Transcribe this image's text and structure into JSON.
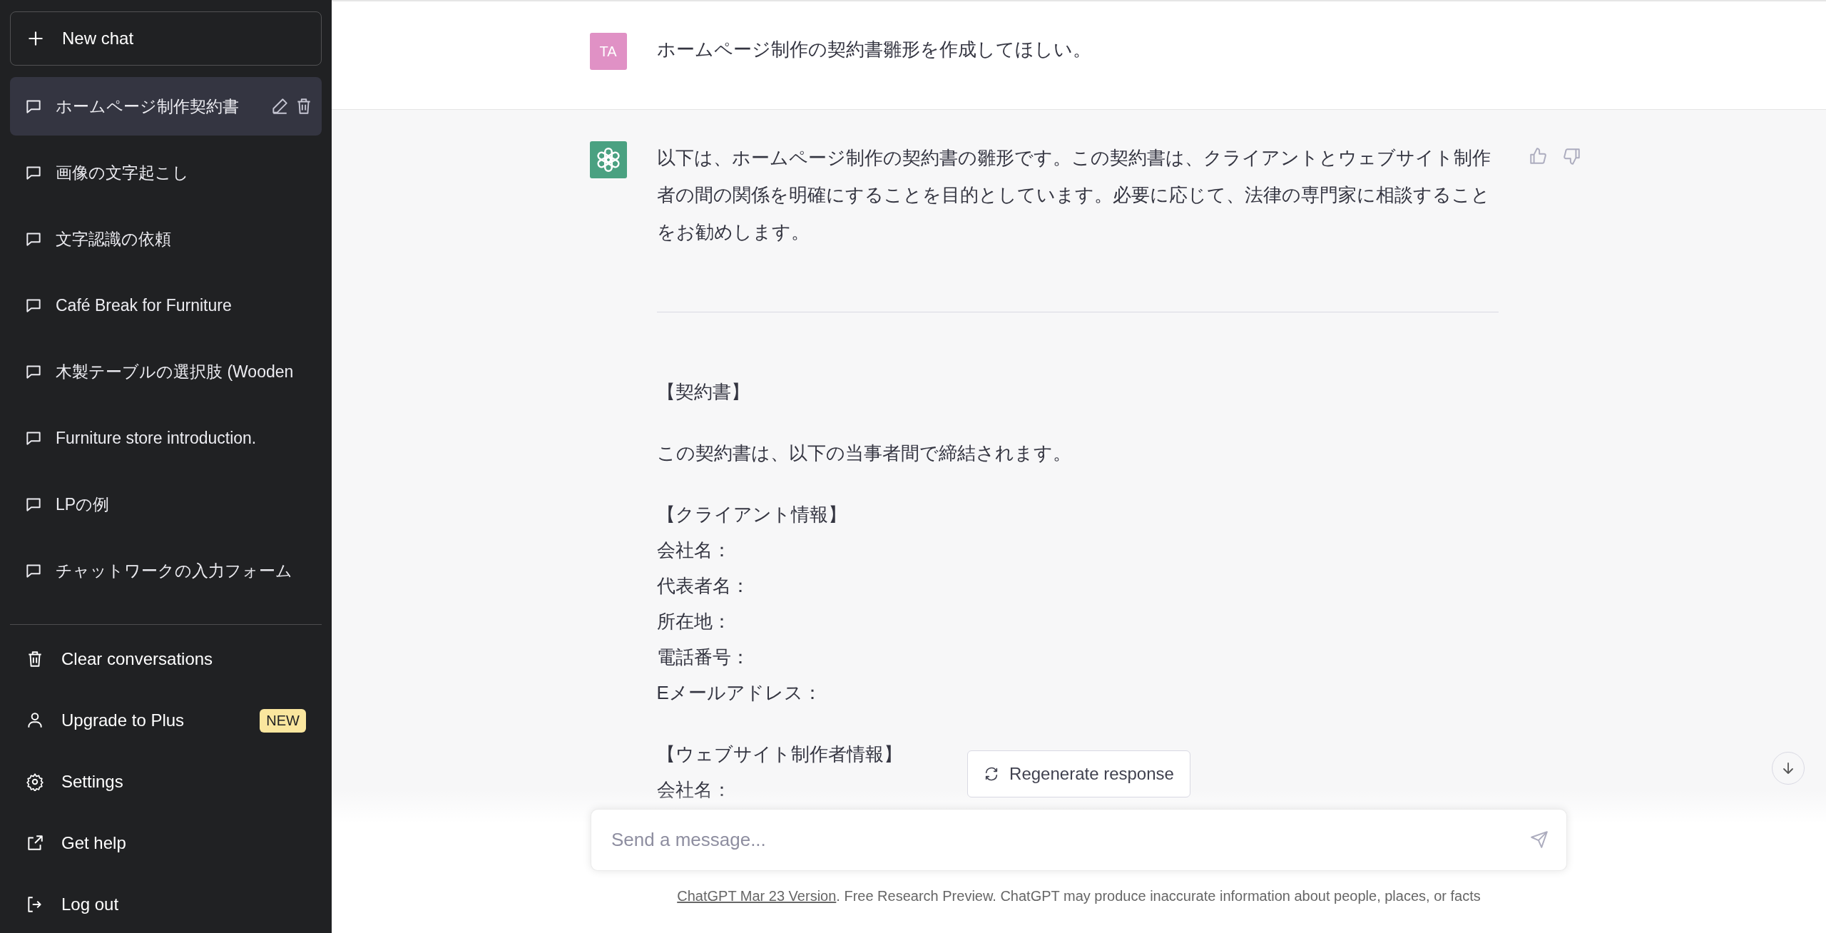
{
  "sidebar": {
    "new_chat": "New chat",
    "conversations": [
      {
        "title": "ホームページ制作契約書",
        "selected": true
      },
      {
        "title": "画像の文字起こし",
        "selected": false
      },
      {
        "title": "文字認識の依頼",
        "selected": false
      },
      {
        "title": "Café Break for Furniture",
        "selected": false
      },
      {
        "title": "木製テーブルの選択肢 (Wooden",
        "selected": false
      },
      {
        "title": "Furniture store introduction.",
        "selected": false
      },
      {
        "title": "LPの例",
        "selected": false
      },
      {
        "title": "チャットワークの入力フォーム",
        "selected": false
      }
    ],
    "menu": [
      {
        "kind": "clear",
        "label": "Clear conversations"
      },
      {
        "kind": "upgrade",
        "label": "Upgrade to Plus",
        "badge": "NEW"
      },
      {
        "kind": "settings",
        "label": "Settings"
      },
      {
        "kind": "help",
        "label": "Get help"
      },
      {
        "kind": "logout",
        "label": "Log out"
      }
    ]
  },
  "messages": [
    {
      "kind": "user",
      "avatar": "TA",
      "text": "ホームページ制作の契約書雛形を作成してほしい。"
    },
    {
      "kind": "assistant",
      "text": "以下は、ホームページ制作の契約書の雛形です。この契約書は、クライアントとウェブサイト制作者の間の関係を明確にすることを目的としています。必要に応じて、法律の専門家に相談することをお勧めします。",
      "content": [
        {
          "kind": "rule"
        },
        {
          "kind": "paragraph",
          "lines": [
            "【契約書】"
          ]
        },
        {
          "kind": "paragraph",
          "lines": [
            "この契約書は、以下の当事者間で締結されます。"
          ]
        },
        {
          "kind": "paragraph",
          "lines": [
            "【クライアント情報】",
            "会社名：",
            "代表者名：",
            "所在地：",
            "電話番号：",
            "Eメールアドレス："
          ]
        },
        {
          "kind": "paragraph",
          "lines": [
            "【ウェブサイト制作者情報】",
            "会社名："
          ]
        }
      ]
    }
  ],
  "regenerate_button": "Regenerate response",
  "composer": {
    "placeholder": "Send a message..."
  },
  "footer": {
    "link": "ChatGPT Mar 23 Version",
    "text": ". Free Research Preview. ChatGPT may produce inaccurate information about people, places, or facts"
  }
}
